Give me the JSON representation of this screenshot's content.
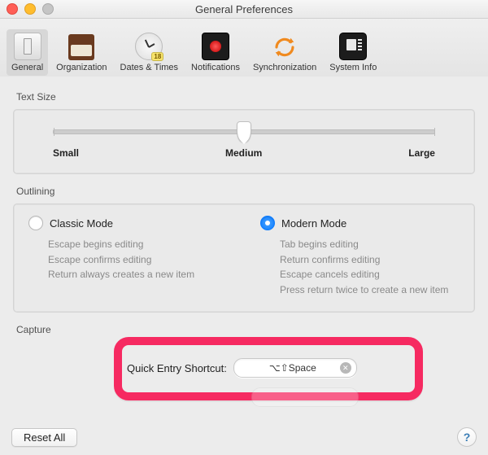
{
  "window": {
    "title": "General Preferences"
  },
  "toolbar": {
    "items": [
      {
        "label": "General",
        "selected": true,
        "icon": "general-icon"
      },
      {
        "label": "Organization",
        "selected": false,
        "icon": "org-icon"
      },
      {
        "label": "Dates & Times",
        "selected": false,
        "icon": "datetime-icon",
        "badge": "18"
      },
      {
        "label": "Notifications",
        "selected": false,
        "icon": "notif-icon"
      },
      {
        "label": "Synchronization",
        "selected": false,
        "icon": "sync-icon"
      },
      {
        "label": "System Info",
        "selected": false,
        "icon": "sysinfo-icon"
      }
    ]
  },
  "text_size": {
    "section_label": "Text Size",
    "ticks": [
      "Small",
      "Medium",
      "Large"
    ],
    "labels": {
      "small": "Small",
      "medium": "Medium",
      "large": "Large"
    },
    "value": "Medium"
  },
  "outlining": {
    "section_label": "Outlining",
    "classic": {
      "label": "Classic Mode",
      "selected": false,
      "hints": [
        "Escape begins editing",
        "Escape confirms editing",
        "Return always creates a new item"
      ]
    },
    "modern": {
      "label": "Modern Mode",
      "selected": true,
      "hints": [
        "Tab begins editing",
        "Return confirms editing",
        "Escape cancels editing",
        "Press return twice to create a new item"
      ]
    }
  },
  "capture": {
    "section_label": "Capture",
    "quick_entry": {
      "label": "Quick Entry Shortcut:",
      "value": "⌥⇧Space"
    }
  },
  "footer": {
    "reset_label": "Reset All",
    "help_label": "?"
  },
  "highlight": {
    "color": "#f62a61"
  }
}
